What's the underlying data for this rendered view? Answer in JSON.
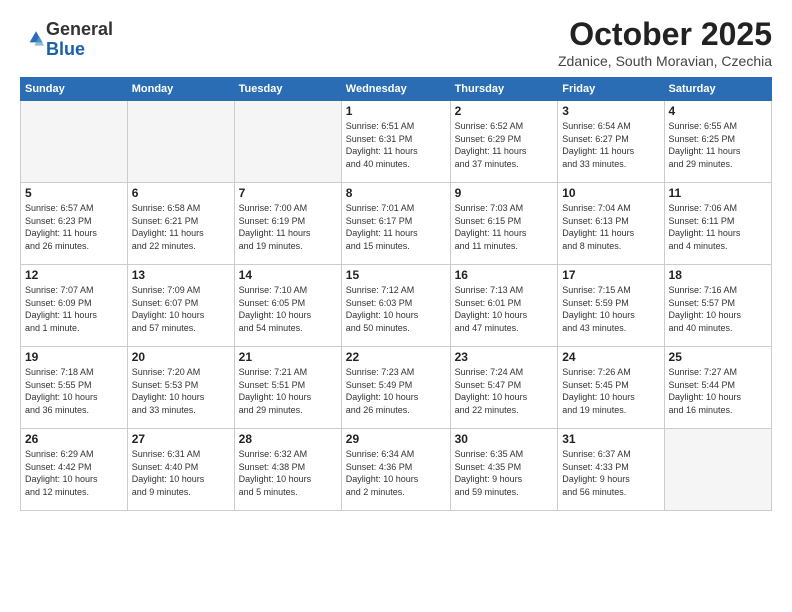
{
  "header": {
    "logo": {
      "line1": "General",
      "line2": "Blue"
    },
    "title": "October 2025",
    "subtitle": "Zdanice, South Moravian, Czechia"
  },
  "weekdays": [
    "Sunday",
    "Monday",
    "Tuesday",
    "Wednesday",
    "Thursday",
    "Friday",
    "Saturday"
  ],
  "weeks": [
    [
      {
        "day": "",
        "info": ""
      },
      {
        "day": "",
        "info": ""
      },
      {
        "day": "",
        "info": ""
      },
      {
        "day": "1",
        "info": "Sunrise: 6:51 AM\nSunset: 6:31 PM\nDaylight: 11 hours\nand 40 minutes."
      },
      {
        "day": "2",
        "info": "Sunrise: 6:52 AM\nSunset: 6:29 PM\nDaylight: 11 hours\nand 37 minutes."
      },
      {
        "day": "3",
        "info": "Sunrise: 6:54 AM\nSunset: 6:27 PM\nDaylight: 11 hours\nand 33 minutes."
      },
      {
        "day": "4",
        "info": "Sunrise: 6:55 AM\nSunset: 6:25 PM\nDaylight: 11 hours\nand 29 minutes."
      }
    ],
    [
      {
        "day": "5",
        "info": "Sunrise: 6:57 AM\nSunset: 6:23 PM\nDaylight: 11 hours\nand 26 minutes."
      },
      {
        "day": "6",
        "info": "Sunrise: 6:58 AM\nSunset: 6:21 PM\nDaylight: 11 hours\nand 22 minutes."
      },
      {
        "day": "7",
        "info": "Sunrise: 7:00 AM\nSunset: 6:19 PM\nDaylight: 11 hours\nand 19 minutes."
      },
      {
        "day": "8",
        "info": "Sunrise: 7:01 AM\nSunset: 6:17 PM\nDaylight: 11 hours\nand 15 minutes."
      },
      {
        "day": "9",
        "info": "Sunrise: 7:03 AM\nSunset: 6:15 PM\nDaylight: 11 hours\nand 11 minutes."
      },
      {
        "day": "10",
        "info": "Sunrise: 7:04 AM\nSunset: 6:13 PM\nDaylight: 11 hours\nand 8 minutes."
      },
      {
        "day": "11",
        "info": "Sunrise: 7:06 AM\nSunset: 6:11 PM\nDaylight: 11 hours\nand 4 minutes."
      }
    ],
    [
      {
        "day": "12",
        "info": "Sunrise: 7:07 AM\nSunset: 6:09 PM\nDaylight: 11 hours\nand 1 minute."
      },
      {
        "day": "13",
        "info": "Sunrise: 7:09 AM\nSunset: 6:07 PM\nDaylight: 10 hours\nand 57 minutes."
      },
      {
        "day": "14",
        "info": "Sunrise: 7:10 AM\nSunset: 6:05 PM\nDaylight: 10 hours\nand 54 minutes."
      },
      {
        "day": "15",
        "info": "Sunrise: 7:12 AM\nSunset: 6:03 PM\nDaylight: 10 hours\nand 50 minutes."
      },
      {
        "day": "16",
        "info": "Sunrise: 7:13 AM\nSunset: 6:01 PM\nDaylight: 10 hours\nand 47 minutes."
      },
      {
        "day": "17",
        "info": "Sunrise: 7:15 AM\nSunset: 5:59 PM\nDaylight: 10 hours\nand 43 minutes."
      },
      {
        "day": "18",
        "info": "Sunrise: 7:16 AM\nSunset: 5:57 PM\nDaylight: 10 hours\nand 40 minutes."
      }
    ],
    [
      {
        "day": "19",
        "info": "Sunrise: 7:18 AM\nSunset: 5:55 PM\nDaylight: 10 hours\nand 36 minutes."
      },
      {
        "day": "20",
        "info": "Sunrise: 7:20 AM\nSunset: 5:53 PM\nDaylight: 10 hours\nand 33 minutes."
      },
      {
        "day": "21",
        "info": "Sunrise: 7:21 AM\nSunset: 5:51 PM\nDaylight: 10 hours\nand 29 minutes."
      },
      {
        "day": "22",
        "info": "Sunrise: 7:23 AM\nSunset: 5:49 PM\nDaylight: 10 hours\nand 26 minutes."
      },
      {
        "day": "23",
        "info": "Sunrise: 7:24 AM\nSunset: 5:47 PM\nDaylight: 10 hours\nand 22 minutes."
      },
      {
        "day": "24",
        "info": "Sunrise: 7:26 AM\nSunset: 5:45 PM\nDaylight: 10 hours\nand 19 minutes."
      },
      {
        "day": "25",
        "info": "Sunrise: 7:27 AM\nSunset: 5:44 PM\nDaylight: 10 hours\nand 16 minutes."
      }
    ],
    [
      {
        "day": "26",
        "info": "Sunrise: 6:29 AM\nSunset: 4:42 PM\nDaylight: 10 hours\nand 12 minutes."
      },
      {
        "day": "27",
        "info": "Sunrise: 6:31 AM\nSunset: 4:40 PM\nDaylight: 10 hours\nand 9 minutes."
      },
      {
        "day": "28",
        "info": "Sunrise: 6:32 AM\nSunset: 4:38 PM\nDaylight: 10 hours\nand 5 minutes."
      },
      {
        "day": "29",
        "info": "Sunrise: 6:34 AM\nSunset: 4:36 PM\nDaylight: 10 hours\nand 2 minutes."
      },
      {
        "day": "30",
        "info": "Sunrise: 6:35 AM\nSunset: 4:35 PM\nDaylight: 9 hours\nand 59 minutes."
      },
      {
        "day": "31",
        "info": "Sunrise: 6:37 AM\nSunset: 4:33 PM\nDaylight: 9 hours\nand 56 minutes."
      },
      {
        "day": "",
        "info": ""
      }
    ]
  ]
}
